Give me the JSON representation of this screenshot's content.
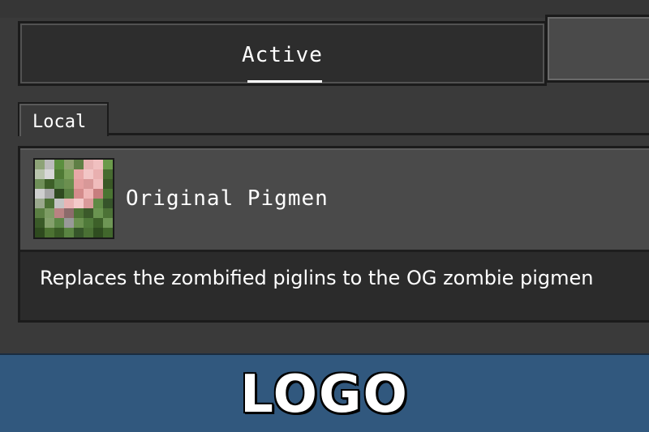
{
  "tabs": {
    "active_label": "Active",
    "inactive_label": ""
  },
  "section": {
    "local_label": "Local"
  },
  "pack": {
    "name": "Original Pigmen",
    "description": "Replaces the zombified piglins to the OG zombie pigmen",
    "icon": "zombie-pigman-pack-icon"
  },
  "watermark": {
    "text": "LOGO"
  },
  "colors": {
    "background": "#3a3a3a",
    "active_tab": "#2d2d2d",
    "pack_row": "#4a4a4a",
    "banner": "#31587e",
    "text": "#ffffff"
  }
}
